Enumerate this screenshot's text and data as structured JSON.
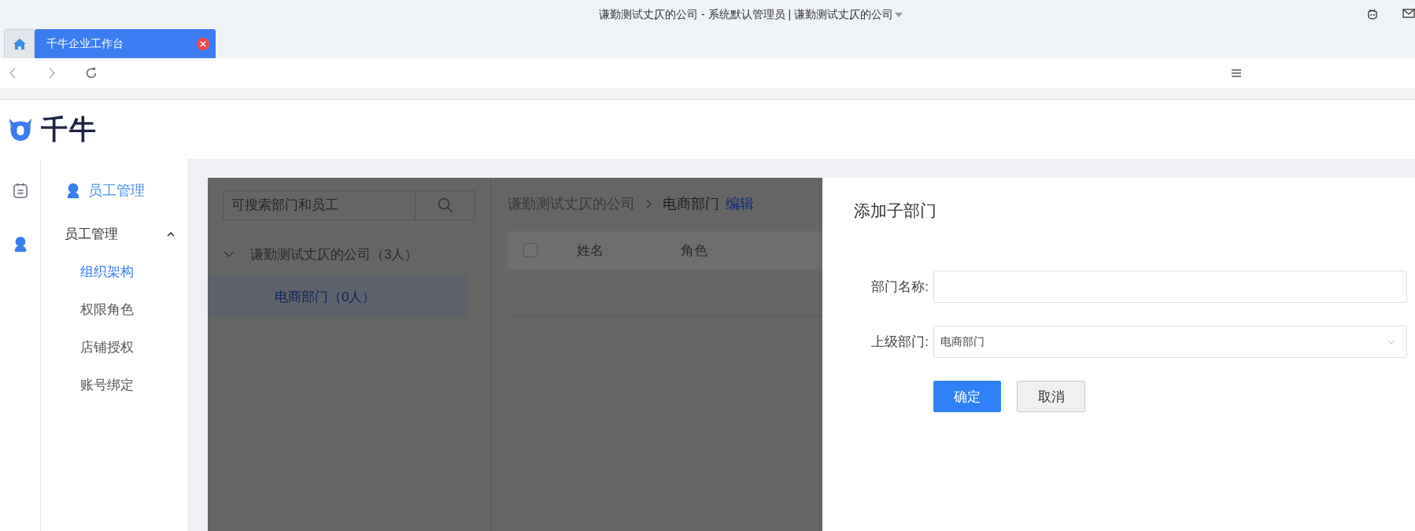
{
  "window": {
    "title": "谦勤测试丈仄的公司 - 系统默认管理员 | 谦勤测试丈仄的公司"
  },
  "tabs": [
    {
      "kind": "home",
      "selected": false
    },
    {
      "kind": "page",
      "label": "千牛企业工作台",
      "selected": true
    }
  ],
  "logo": {
    "text": "千牛"
  },
  "rail": [
    {
      "kind": "clipboard",
      "selected": false
    },
    {
      "kind": "person",
      "selected": true
    }
  ],
  "sidebar": {
    "header": "员工管理",
    "group": {
      "label": "员工管理",
      "expanded": true,
      "items": [
        {
          "label": "组织架构",
          "selected": true
        },
        {
          "label": "权限角色",
          "selected": false
        },
        {
          "label": "店铺授权",
          "selected": false
        },
        {
          "label": "账号绑定",
          "selected": false
        }
      ]
    }
  },
  "tree": {
    "search": {
      "placeholder": "可搜索部门和员工"
    },
    "nodes": [
      {
        "label": "谦勤测试丈仄的公司（3人）",
        "expanded": true,
        "children": [
          {
            "label": "电商部门（0人）",
            "selected": true
          }
        ]
      }
    ]
  },
  "breadcrumb": [
    "谦勤测试丈仄的公司",
    "电商部门"
  ],
  "edit_link": "编辑",
  "table": {
    "select_all": {
      "checked": false
    },
    "columns": [
      "姓名",
      "角色"
    ]
  },
  "dialog": {
    "title": "添加子部门",
    "fields": [
      {
        "label": "部门名称:",
        "kind": "text"
      },
      {
        "label": "上级部门:",
        "kind": "select",
        "value": "电商部门"
      }
    ],
    "buttons": [
      {
        "label": "确定",
        "kind": "primary"
      },
      {
        "label": "取消",
        "kind": "default"
      }
    ]
  }
}
